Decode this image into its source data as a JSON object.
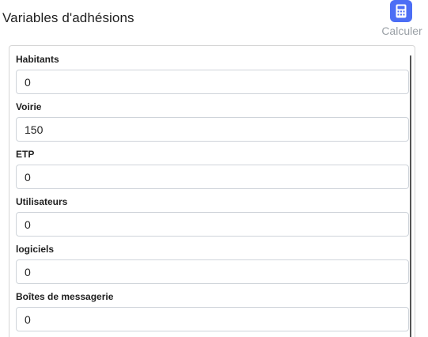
{
  "header": {
    "title": "Variables d'adhésions"
  },
  "toolbar": {
    "calculate_label": "Calculer",
    "calculate_icon": "calculator-icon",
    "accent_color": "#4c6ef5"
  },
  "fields": [
    {
      "label": "Habitants",
      "value": "0"
    },
    {
      "label": "Voirie",
      "value": "150"
    },
    {
      "label": "ETP",
      "value": "0"
    },
    {
      "label": "Utilisateurs",
      "value": "0"
    },
    {
      "label": "logiciels",
      "value": "0"
    },
    {
      "label": "Boîtes de messagerie",
      "value": "0"
    }
  ]
}
